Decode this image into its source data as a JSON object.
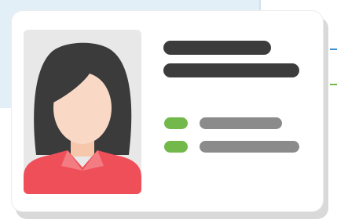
{
  "card": {
    "type": "id-card",
    "photo_icon": "user-avatar-female-icon",
    "name_lines": 2,
    "info_rows": [
      {
        "bullet_color": "#72b84b",
        "line_color": "#8b8b8b"
      },
      {
        "bullet_color": "#72b84b",
        "line_color": "#8b8b8b"
      }
    ]
  },
  "colors": {
    "background_panel": "#e3eff7",
    "name_placeholder": "#3c3c3c",
    "bullet": "#72b84b",
    "info_placeholder": "#8b8b8b",
    "hair": "#3b3b3b",
    "skin": "#f9d9c6",
    "shirt": "#ef4f59",
    "accent_blue": "#3c8fcf"
  }
}
